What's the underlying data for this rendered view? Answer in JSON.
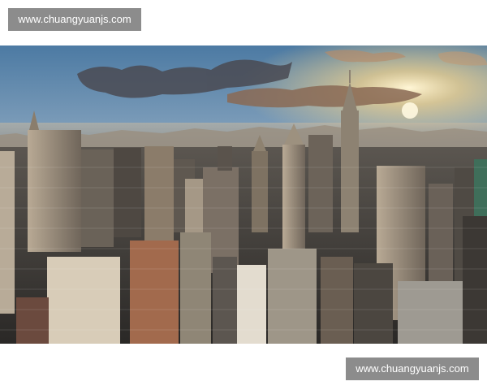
{
  "watermarks": {
    "top_text": "www.chuangyuanjs.com",
    "bottom_text": "www.chuangyuanjs.com"
  },
  "colors": {
    "watermark_bg": "#8c8c8c",
    "sky_top": "#4f7fa8",
    "sky_horizon": "#f3c27a",
    "sun": "#fff3c8",
    "buildings": "#2b2b30"
  }
}
